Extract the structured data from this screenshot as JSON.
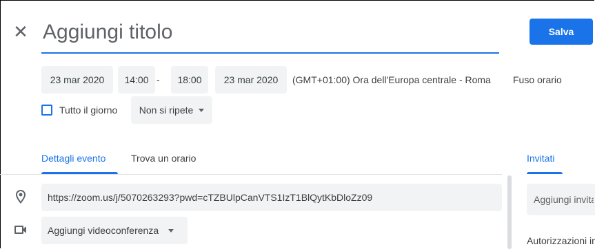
{
  "header": {
    "close_icon": "close-icon",
    "title_placeholder": "Aggiungi titolo",
    "save_label": "Salva"
  },
  "datetime": {
    "start_date": "23 mar 2020",
    "start_time": "14:00",
    "separator": "-",
    "end_time": "18:00",
    "end_date": "23 mar 2020",
    "timezone": "(GMT+01:00) Ora dell'Europa centrale - Roma",
    "timezone_button": "Fuso orario"
  },
  "options": {
    "all_day_label": "Tutto il giorno",
    "all_day_checked": false,
    "repeat_label": "Non si ripete"
  },
  "tabs": {
    "event_details": "Dettagli evento",
    "find_time": "Trova un orario",
    "active": "Dettagli evento"
  },
  "details": {
    "location_icon": "location-pin-icon",
    "location_value": "https://zoom.us/j/5070263293?pwd=cTZBUlpCanVTS1IzT1BlQytKbDloZz09",
    "video_icon": "videocam-icon",
    "video_label": "Aggiungi videoconferenza"
  },
  "guests": {
    "tab_label": "Invitati",
    "input_placeholder": "Aggiungi invitati",
    "permissions_label": "Autorizzazioni invitati"
  },
  "colors": {
    "accent": "#1a73e8",
    "chip_bg": "#f1f3f4",
    "text": "#3c4043"
  }
}
